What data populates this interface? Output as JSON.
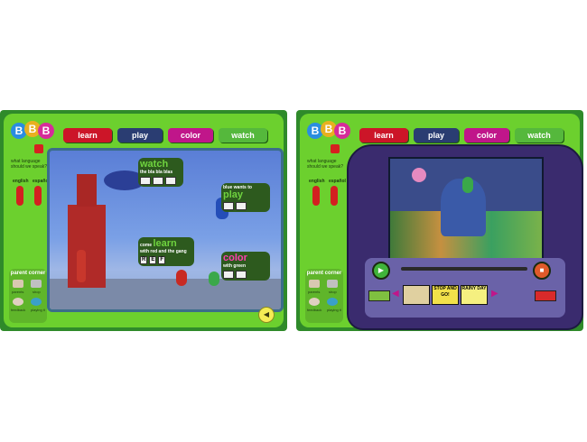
{
  "logo": {
    "letters": [
      "B",
      "B",
      "B"
    ]
  },
  "tabs": {
    "learn": "learn",
    "play": "play",
    "color": "color",
    "watch": "watch"
  },
  "language": {
    "question": "what language should we speak?",
    "english": "english",
    "espanol": "español"
  },
  "parent_corner": {
    "title": "parent corner",
    "parents": "parents",
    "shop": "shop",
    "feedback": "feedback",
    "playing": "playing it"
  },
  "left_scene": {
    "watch_big": "watch",
    "watch_rest": "the bla bla blas",
    "play_pre": "blue wants to",
    "play_big": "play",
    "learn_pre": "come",
    "learn_big": "learn",
    "learn_post": "with red and the gang",
    "color_big": "color",
    "color_post": "with green",
    "letters": [
      "R",
      "E",
      "F"
    ]
  },
  "right_scene": {
    "thumb1": "STOP AND GO!",
    "thumb2": "RAINY DAY"
  },
  "colors": {
    "learn": "#cc1528",
    "play": "#2a3d72",
    "color": "#c0168a",
    "watch": "#55b83c",
    "frame": "#6cd02e"
  }
}
